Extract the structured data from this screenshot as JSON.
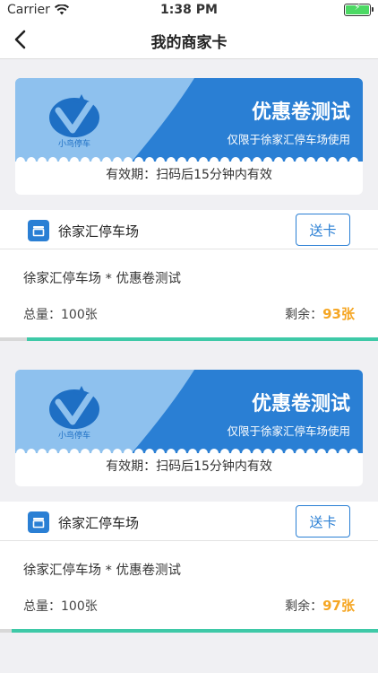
{
  "status": {
    "carrier": "Carrier",
    "time": "1:38 PM"
  },
  "nav": {
    "title": "我的商家卡"
  },
  "cards": [
    {
      "coupon_name": "优惠卷测试",
      "scope": "仅限于徐家汇停车场使用",
      "logo_text": "小鸟停车",
      "validity": "有效期：扫码后15分钟内有效",
      "store": "徐家汇停车场",
      "send_label": "送卡",
      "detail": "徐家汇停车场 * 优惠卷测试",
      "total": "总量：100张",
      "remain_label": "剩余：",
      "remain_value": "93张",
      "remain_fraction": 0.93
    },
    {
      "coupon_name": "优惠卷测试",
      "scope": "仅限于徐家汇停车场使用",
      "logo_text": "小鸟停车",
      "validity": "有效期：扫码后15分钟内有效",
      "store": "徐家汇停车场",
      "send_label": "送卡",
      "detail": "徐家汇停车场 * 优惠卷测试",
      "total": "总量：100张",
      "remain_label": "剩余：",
      "remain_value": "97张",
      "remain_fraction": 0.97
    }
  ],
  "colors": {
    "accent": "#2a7fd4",
    "remain": "#f5a623",
    "progress": "#3ec9a7",
    "coupon_light": "#8ec1ee",
    "coupon_dark": "#2a7fd4"
  },
  "icons": {
    "back": "chevron-left-icon",
    "wifi": "wifi-icon",
    "store": "store-icon",
    "logo": "bird-logo-icon"
  }
}
